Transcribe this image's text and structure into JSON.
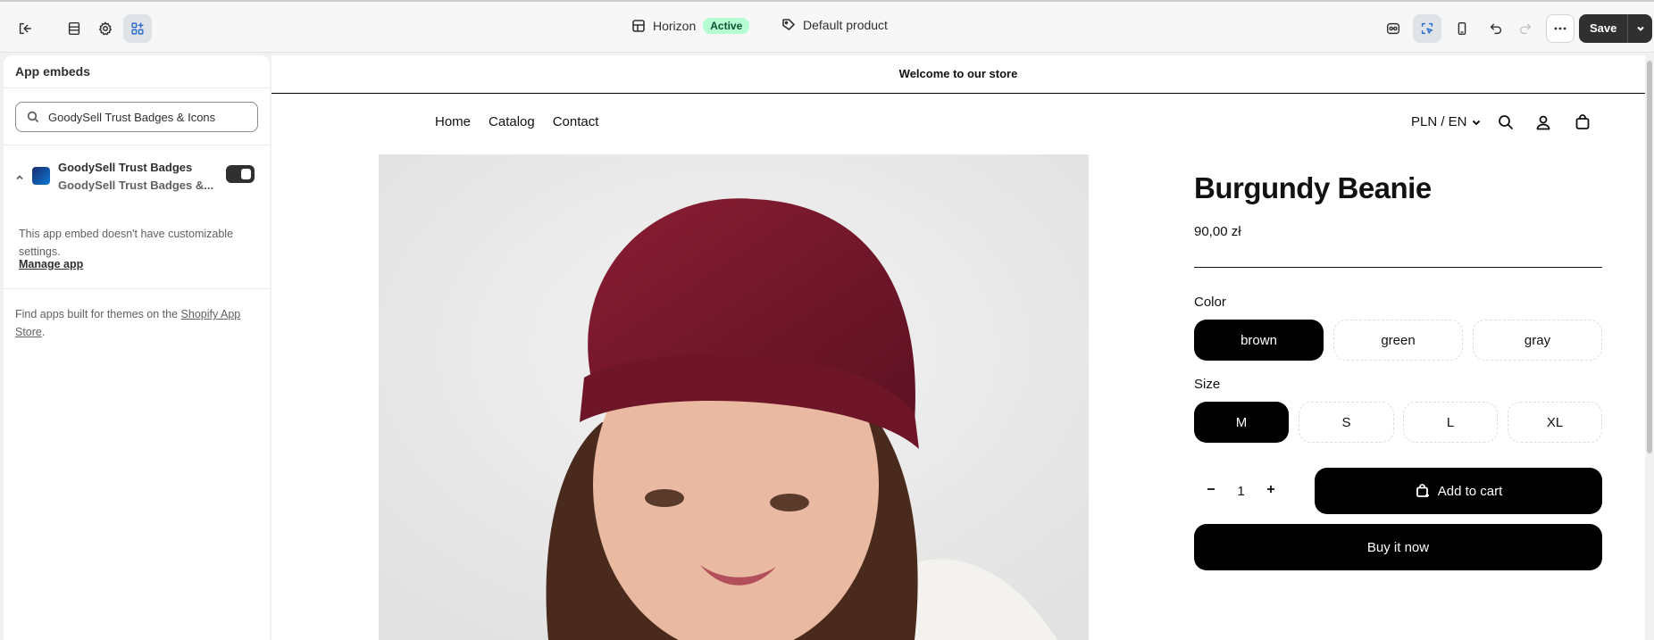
{
  "topbar": {
    "theme_name": "Horizon",
    "theme_status": "Active",
    "template_name": "Default product",
    "save_label": "Save"
  },
  "sidebar": {
    "title": "App embeds",
    "search_value": "GoodySell Trust Badges & Icons",
    "embed": {
      "name": "GoodySell Trust Badges",
      "subtitle": "GoodySell Trust Badges &...",
      "enabled": true,
      "message": "This app embed doesn't have customizable settings.",
      "manage_label": "Manage app"
    },
    "find_apps_prefix": "Find apps built for themes on the ",
    "find_apps_link": "Shopify App Store",
    "find_apps_suffix": "."
  },
  "store": {
    "announcement": "Welcome to our store",
    "nav": [
      "Home",
      "Catalog",
      "Contact"
    ],
    "locale": "PLN / EN"
  },
  "product": {
    "title": "Burgundy Beanie",
    "price": "90,00 zł",
    "color_label": "Color",
    "colors": [
      "brown",
      "green",
      "gray"
    ],
    "selected_color": "brown",
    "size_label": "Size",
    "sizes": [
      "M",
      "S",
      "L",
      "XL"
    ],
    "selected_size": "M",
    "quantity": "1",
    "add_to_cart": "Add to cart",
    "buy_now": "Buy it now"
  },
  "colors": {
    "accent": "#2c6ecb",
    "active_badge_bg": "#b4fed2",
    "beanie": "#7a1a2c"
  }
}
